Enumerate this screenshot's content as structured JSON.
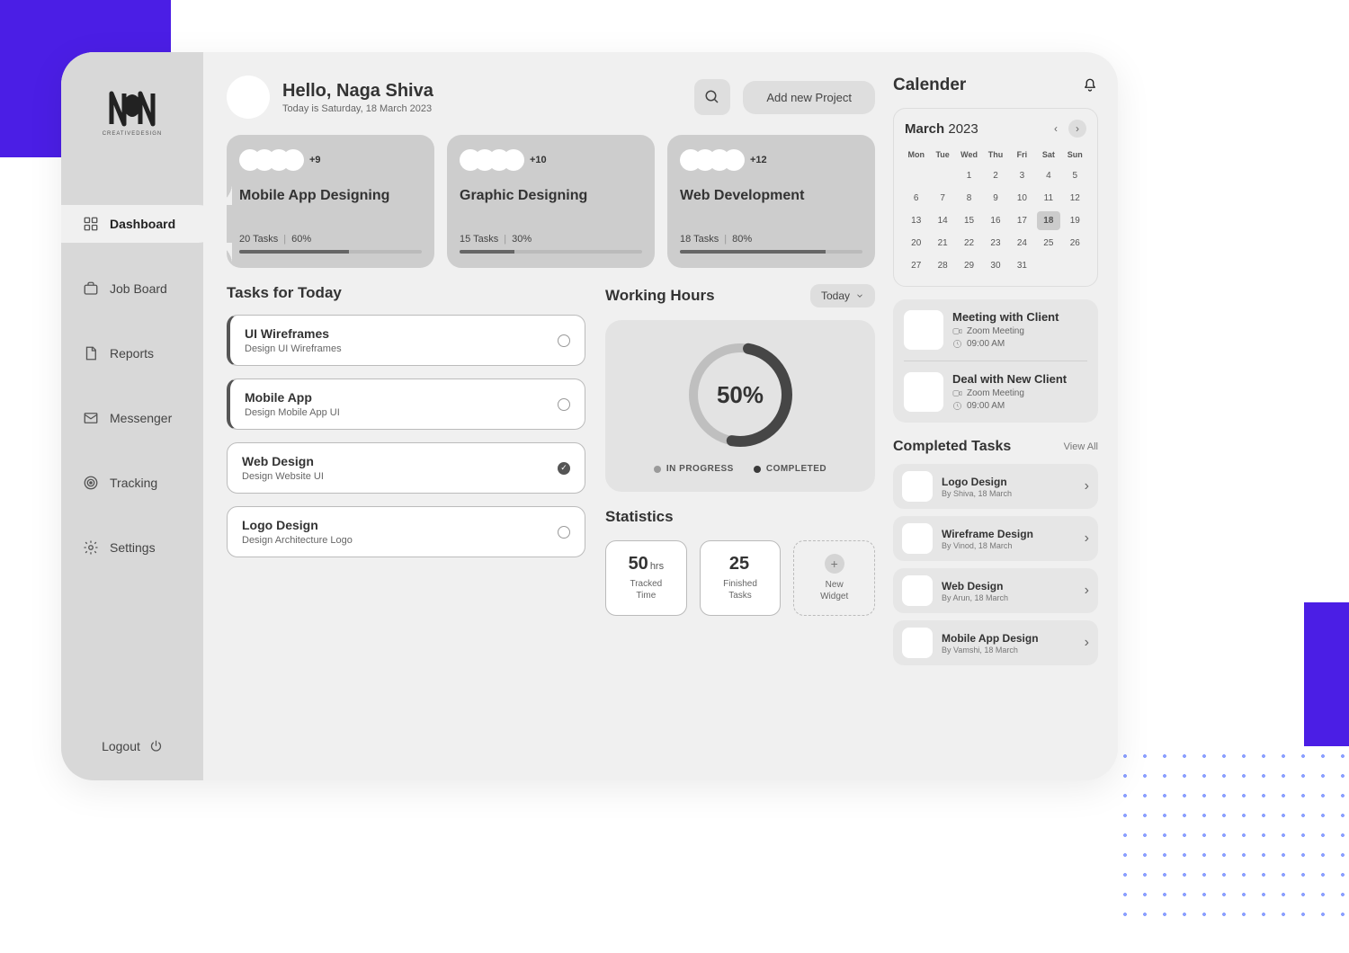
{
  "sidebar": {
    "logo_sub": "CREATIVEDESIGN",
    "items": [
      {
        "label": "Dashboard",
        "icon": "grid"
      },
      {
        "label": "Job Board",
        "icon": "briefcase"
      },
      {
        "label": "Reports",
        "icon": "file"
      },
      {
        "label": "Messenger",
        "icon": "mail"
      },
      {
        "label": "Tracking",
        "icon": "target"
      },
      {
        "label": "Settings",
        "icon": "gear"
      }
    ],
    "logout": "Logout"
  },
  "header": {
    "greeting": "Hello, Naga Shiva",
    "subtitle": "Today is Saturday, 18 March 2023",
    "add_project": "Add new Project"
  },
  "projects": [
    {
      "title": "Mobile App Designing",
      "more": "+9",
      "tasks": "20 Tasks",
      "pct": "60%",
      "bar": 60
    },
    {
      "title": "Graphic Designing",
      "more": "+10",
      "tasks": "15 Tasks",
      "pct": "30%",
      "bar": 30
    },
    {
      "title": "Web Development",
      "more": "+12",
      "tasks": "18 Tasks",
      "pct": "80%",
      "bar": 80
    }
  ],
  "tasks_title": "Tasks  for Today",
  "tasks": [
    {
      "title": "UI Wireframes",
      "sub": "Design UI Wireframes",
      "done": false,
      "sel": true
    },
    {
      "title": "Mobile App",
      "sub": "Design Mobile App UI",
      "done": false,
      "sel": true
    },
    {
      "title": "Web Design",
      "sub": "Design Website UI",
      "done": true,
      "sel": false
    },
    {
      "title": "Logo Design",
      "sub": "Design Architecture Logo",
      "done": false,
      "sel": false
    }
  ],
  "working": {
    "title": "Working Hours",
    "dropdown": "Today",
    "pct": "50%",
    "legend_a": "IN PROGRESS",
    "legend_b": "COMPLETED"
  },
  "chart_data": {
    "type": "pie",
    "title": "Working Hours",
    "series": [
      {
        "name": "IN PROGRESS",
        "value": 50,
        "color": "#bfbfbf"
      },
      {
        "name": "COMPLETED",
        "value": 50,
        "color": "#464646"
      }
    ]
  },
  "stats": {
    "title": "Statistics",
    "cards": [
      {
        "val": "50",
        "unit": "hrs",
        "lbl": "Tracked Time"
      },
      {
        "val": "25",
        "unit": "",
        "lbl": "Finished Tasks"
      }
    ],
    "new_label": "New Widget"
  },
  "calendar": {
    "title": "Calender",
    "month": "March",
    "year": "2023",
    "dow": [
      "Mon",
      "Tue",
      "Wed",
      "Thu",
      "Fri",
      "Sat",
      "Sun"
    ],
    "first_weekday": 2,
    "days_in_month": 31,
    "today": 18
  },
  "events": [
    {
      "title": "Meeting with Client",
      "type": "Zoom Meeting",
      "time": "09:00 AM"
    },
    {
      "title": "Deal with New Client",
      "type": "Zoom Meeting",
      "time": "09:00 AM"
    }
  ],
  "completed": {
    "title": "Completed Tasks",
    "view_all": "View All",
    "items": [
      {
        "title": "Logo Design",
        "sub": "By Shiva, 18 March"
      },
      {
        "title": "Wireframe Design",
        "sub": "By Vinod, 18 March"
      },
      {
        "title": "Web Design",
        "sub": "By Arun, 18 March"
      },
      {
        "title": "Mobile App Design",
        "sub": "By Vamshi, 18 March"
      }
    ]
  }
}
